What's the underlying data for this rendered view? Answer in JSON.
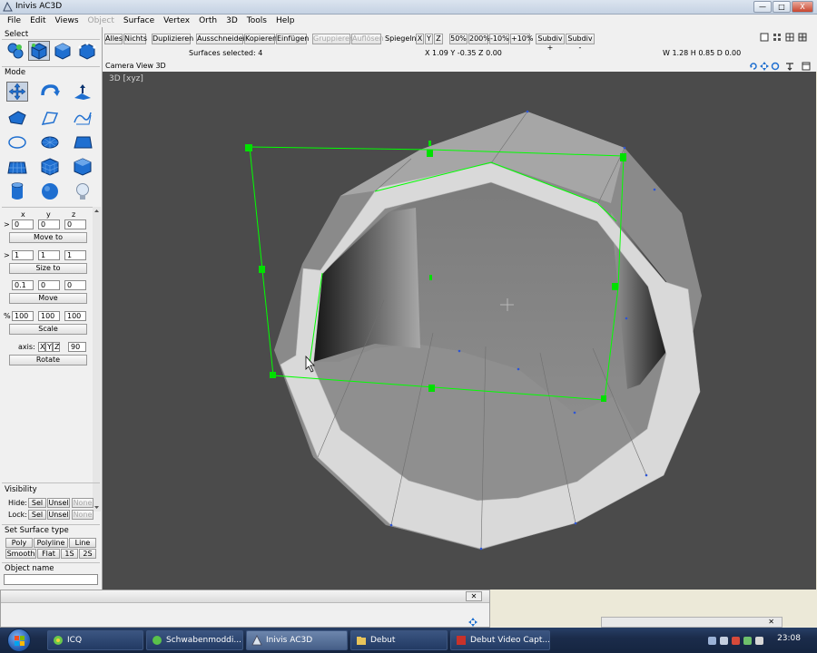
{
  "window": {
    "title": "Inivis AC3D",
    "minimize": "—",
    "maximize": "□",
    "close": "X"
  },
  "menu": [
    {
      "label": "File",
      "enabled": true
    },
    {
      "label": "Edit",
      "enabled": true
    },
    {
      "label": "Views",
      "enabled": true
    },
    {
      "label": "Object",
      "enabled": false
    },
    {
      "label": "Surface",
      "enabled": true
    },
    {
      "label": "Vertex",
      "enabled": true
    },
    {
      "label": "Orth",
      "enabled": true
    },
    {
      "label": "3D",
      "enabled": true
    },
    {
      "label": "Tools",
      "enabled": true
    },
    {
      "label": "Help",
      "enabled": true
    }
  ],
  "sidebar": {
    "select_label": "Select",
    "mode_label": "Mode",
    "xyz": {
      "x": "x",
      "y": "y",
      "z": "z"
    },
    "move_to": {
      "values": [
        "0",
        "0",
        "0"
      ],
      "label": "Move to"
    },
    "size_to": {
      "values": [
        "1",
        "1",
        "1"
      ],
      "label": "Size to"
    },
    "move": {
      "values": [
        "0.1",
        "0",
        "0"
      ],
      "label": "Move"
    },
    "scale": {
      "prefix": "%",
      "values": [
        "100",
        "100",
        "100"
      ],
      "label": "Scale"
    },
    "rotate": {
      "axis_label": "axis:",
      "axes": [
        "X",
        "Y",
        "Z"
      ],
      "angle": "90",
      "label": "Rotate"
    },
    "visibility_label": "Visibility",
    "hide": {
      "label": "Hide:",
      "sel": "Sel",
      "unsel": "Unsel",
      "none": "None"
    },
    "lock": {
      "label": "Lock:",
      "sel": "Sel",
      "unsel": "Unsel",
      "none": "None"
    },
    "surface_type_label": "Set Surface type",
    "surface_types": [
      "Poly",
      "Polyline",
      "Line"
    ],
    "shading": [
      "Smooth",
      "Flat",
      "1S",
      "2S"
    ],
    "object_name_label": "Object name"
  },
  "toolbar": {
    "buttons": [
      "Alles",
      "Nichts",
      "Duplizieren",
      "Ausschneiden",
      "Kopieren",
      "Einfügen",
      "Gruppieren",
      "Auflösen"
    ],
    "mirror_label": "Spiegeln:",
    "mirror_axes": [
      "X",
      "Y",
      "Z"
    ],
    "zoom_buttons": [
      "50%",
      "200%",
      "-10%",
      "+10%"
    ],
    "subdiv_buttons": [
      "Subdiv +",
      "Subdiv -"
    ],
    "surfaces_selected": "Surfaces selected: 4",
    "coordinates": "X 1.09 Y -0.35 Z 0.00",
    "dimensions": "W 1.28 H 0.85 D 0.00"
  },
  "viewport": {
    "header": "Camera View 3D",
    "label": "3D [xyz]",
    "background": "#4b4b4b",
    "selection_color": "#00ff00"
  },
  "taskbar": {
    "tasks": [
      {
        "label": "ICQ",
        "active": false
      },
      {
        "label": "Schwabenmoddi...",
        "active": false
      },
      {
        "label": "Inivis AC3D",
        "active": true
      },
      {
        "label": "Debut",
        "active": false
      },
      {
        "label": "Debut Video Capt...",
        "active": false
      }
    ],
    "clock": "23:08"
  }
}
